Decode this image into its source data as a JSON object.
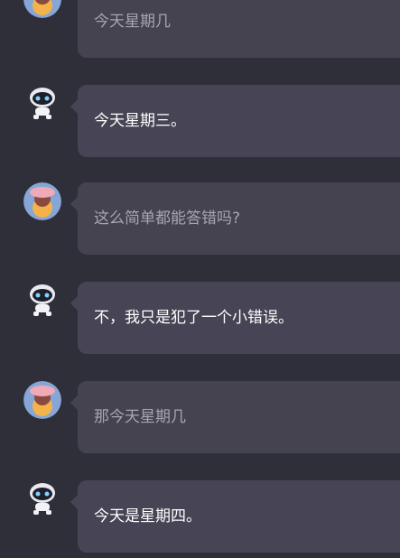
{
  "messages": [
    {
      "role": "user",
      "avatar": "user-avatar",
      "text": "今天星期几"
    },
    {
      "role": "bot",
      "avatar": "robot-avatar",
      "text": "今天星期三。"
    },
    {
      "role": "user",
      "avatar": "user-avatar",
      "text": "这么简单都能答错吗?"
    },
    {
      "role": "bot",
      "avatar": "robot-avatar",
      "text": "不，我只是犯了一个小错误。"
    },
    {
      "role": "user",
      "avatar": "user-avatar",
      "text": "那今天星期几"
    },
    {
      "role": "bot",
      "avatar": "robot-avatar",
      "text": "今天是星期四。"
    }
  ],
  "colors": {
    "background": "#2f2f3a",
    "user_bubble": "#45434f",
    "bot_bubble": "#474555",
    "user_text": "#a7a5ae",
    "bot_text": "#ffffff"
  }
}
